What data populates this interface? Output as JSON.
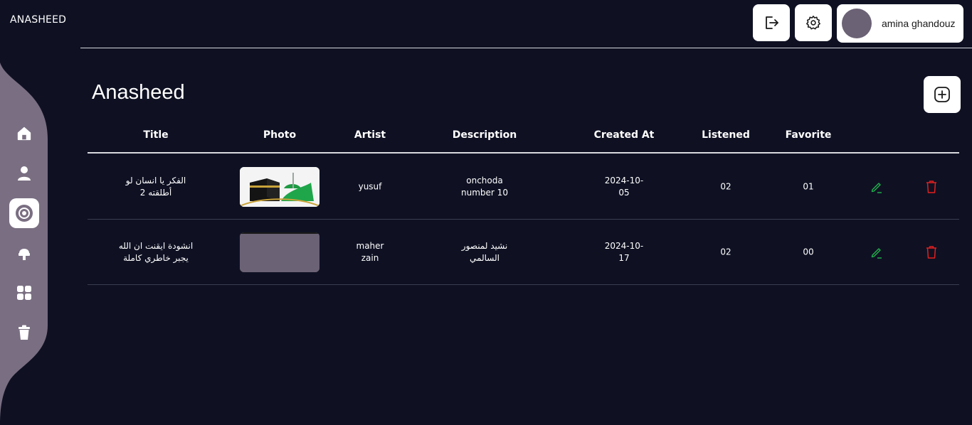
{
  "brand": "ANASHEED",
  "user": {
    "name": "amina ghandouz"
  },
  "header": {
    "logout_icon": "logout-icon",
    "settings_icon": "gear-icon"
  },
  "sidebar": {
    "items": [
      {
        "icon": "home-icon",
        "active": false
      },
      {
        "icon": "user-icon",
        "active": false
      },
      {
        "icon": "disc-icon",
        "active": true
      },
      {
        "icon": "microphone-icon",
        "active": false
      },
      {
        "icon": "grid-icon",
        "active": false
      },
      {
        "icon": "trash-icon",
        "active": false
      }
    ]
  },
  "main": {
    "title": "Anasheed",
    "add_icon": "plus-circle-icon"
  },
  "table": {
    "columns": [
      "Title",
      "Photo",
      "Artist",
      "Description",
      "Created At",
      "Listened",
      "Favorite"
    ],
    "rows": [
      {
        "title": "الفكر يا انسان لو أطلقته 2",
        "photo": "kaaba-mosque-image",
        "artist": "yusuf",
        "description": "onchoda number 10",
        "created_at": "2024-10-05",
        "listened": "02",
        "favorite": "01"
      },
      {
        "title": "انشودة ايقنت ان الله يجبر خاطري كاملة",
        "photo": "placeholder-image",
        "artist": "maher zain",
        "description": "نشيد لمنصور السالمي",
        "created_at": "2024-10-17",
        "listened": "02",
        "favorite": "00"
      }
    ]
  },
  "colors": {
    "background": "#0f1123",
    "sidebar": "#7a6f82",
    "edit": "#22b24c",
    "delete": "#e02020"
  }
}
